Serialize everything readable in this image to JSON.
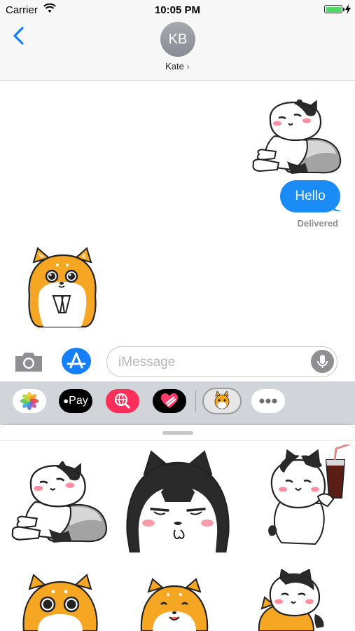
{
  "status_bar": {
    "carrier": "Carrier",
    "time": "10:05 PM"
  },
  "header": {
    "avatar_initials": "KB",
    "contact_name": "Kate",
    "contact_chevron": "›"
  },
  "messages": [
    {
      "type": "sticker",
      "from": "me",
      "icon": "husky-lounging-sticker"
    },
    {
      "type": "text",
      "from": "me",
      "text": "Hello"
    },
    {
      "type": "status",
      "text": "Delivered"
    },
    {
      "type": "sticker",
      "from": "other",
      "icon": "shiba-pleading-sticker"
    }
  ],
  "input": {
    "placeholder": "iMessage"
  },
  "app_tray": {
    "apple_pay_label": "Pay"
  },
  "colors": {
    "bubble": "#1b8cf5",
    "accent": "#147efb",
    "battery": "#4cd964"
  }
}
